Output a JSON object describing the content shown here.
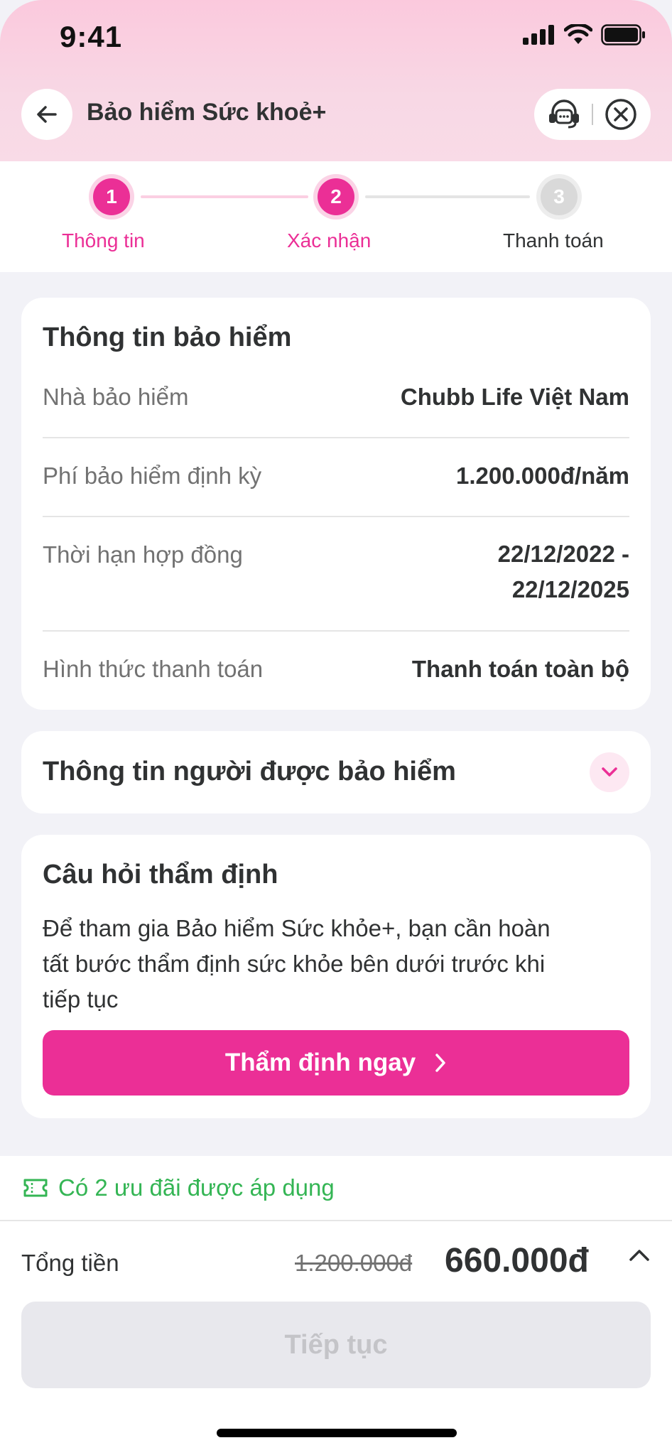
{
  "status_bar": {
    "time": "9:41"
  },
  "nav": {
    "title": "Bảo hiểm Sức khoẻ+"
  },
  "stepper": {
    "steps": [
      {
        "number": "1",
        "label": "Thông tin"
      },
      {
        "number": "2",
        "label": "Xác nhận"
      },
      {
        "number": "3",
        "label": "Thanh toán"
      }
    ]
  },
  "insurance_info": {
    "title": "Thông tin bảo hiểm",
    "rows": [
      {
        "label": "Nhà bảo hiểm",
        "value": "Chubb Life Việt Nam"
      },
      {
        "label": "Phí bảo hiểm định kỳ",
        "value": "1.200.000đ/năm"
      },
      {
        "label": "Thời hạn hợp đồng",
        "value_line1": "22/12/2022 -",
        "value_line2": "22/12/2025"
      },
      {
        "label": "Hình thức thanh toán",
        "value": "Thanh toán toàn bộ"
      }
    ]
  },
  "insured_person": {
    "title": "Thông tin người được bảo hiểm"
  },
  "assessment": {
    "title": "Câu hỏi thẩm định",
    "line1": "Để tham gia Bảo hiểm Sức khỏe+, bạn cần hoàn",
    "line2": "tất bước thẩm định sức khỏe bên dưới trước khi",
    "line3": "tiếp tục",
    "button_label": "Thẩm định ngay"
  },
  "promo": {
    "text": "Có 2 ưu đãi được áp dụng"
  },
  "summary": {
    "total_label": "Tổng tiền",
    "old_price": "1.200.000đ",
    "new_price": "660.000đ",
    "continue_label": "Tiếp tục"
  },
  "colors": {
    "accent": "#eb2f96",
    "success": "#34b554",
    "disabled_bg": "#e8e8ed"
  }
}
